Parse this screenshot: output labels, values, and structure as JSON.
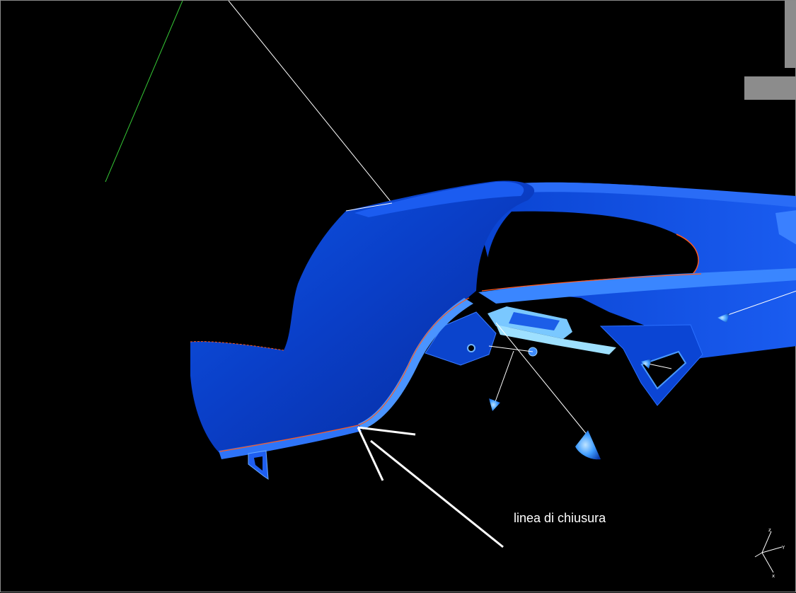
{
  "viewport": {
    "background": "#000000",
    "part_color": "#0a46d8",
    "part_highlight": "#3c8cff",
    "edge_color": "#ff5a1e",
    "construction_line_color": "#ffffff",
    "axis_line_color": "#35c835"
  },
  "annotation": {
    "label": "linea di chiusura"
  },
  "triad": {
    "x_label": "x",
    "y_label": "Y",
    "z_label": "z"
  },
  "icons": {
    "cone_marker": "direction-cone-icon",
    "axis_triad": "axis-triad-icon"
  }
}
